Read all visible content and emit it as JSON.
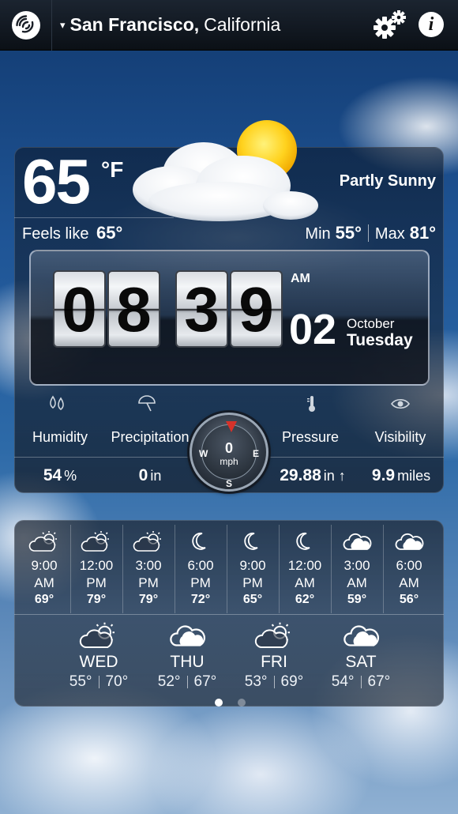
{
  "header": {
    "location_city": "San Francisco,",
    "location_state": "California",
    "location_caret": "▾"
  },
  "current": {
    "temperature": "65",
    "unit": "°F",
    "condition": "Partly Sunny",
    "feels_like_label": "Feels like",
    "feels_like_value": "65°",
    "min_label": "Min",
    "min_value": "55°",
    "max_label": "Max",
    "max_value": "81°"
  },
  "clock": {
    "h1": "0",
    "h2": "8",
    "m1": "3",
    "m2": "9",
    "ampm": "AM",
    "day": "02",
    "month": "October",
    "weekday": "Tuesday"
  },
  "stats": {
    "humidity": {
      "label": "Humidity",
      "value": "54",
      "unit": "%"
    },
    "precipitation": {
      "label": "Precipitation",
      "value": "0",
      "unit": "in"
    },
    "pressure": {
      "label": "Pressure",
      "value": "29.88",
      "unit": "in ↑"
    },
    "visibility": {
      "label": "Visibility",
      "value": "9.9",
      "unit": "miles"
    }
  },
  "wind": {
    "speed": "0",
    "unit": "mph",
    "n": "N",
    "e": "E",
    "s": "S",
    "w": "W"
  },
  "hourly": [
    {
      "time": "9:00",
      "period": "AM",
      "temp": "69°",
      "icon": "partly-sunny-icon"
    },
    {
      "time": "12:00",
      "period": "PM",
      "temp": "79°",
      "icon": "partly-sunny-icon"
    },
    {
      "time": "3:00",
      "period": "PM",
      "temp": "79°",
      "icon": "partly-sunny-icon"
    },
    {
      "time": "6:00",
      "period": "PM",
      "temp": "72°",
      "icon": "moon-icon"
    },
    {
      "time": "9:00",
      "period": "PM",
      "temp": "65°",
      "icon": "moon-icon"
    },
    {
      "time": "12:00",
      "period": "AM",
      "temp": "62°",
      "icon": "moon-icon"
    },
    {
      "time": "3:00",
      "period": "AM",
      "temp": "59°",
      "icon": "cloud-icon"
    },
    {
      "time": "6:00",
      "period": "AM",
      "temp": "56°",
      "icon": "cloud-icon"
    }
  ],
  "daily": [
    {
      "day": "WED",
      "min": "55°",
      "max": "70°",
      "icon": "partly-sunny-icon"
    },
    {
      "day": "THU",
      "min": "52°",
      "max": "67°",
      "icon": "cloud-icon"
    },
    {
      "day": "FRI",
      "min": "53°",
      "max": "69°",
      "icon": "partly-sunny-icon"
    },
    {
      "day": "SAT",
      "min": "54°",
      "max": "67°",
      "icon": "cloud-icon"
    }
  ],
  "pager": {
    "pages": 2,
    "active": 1
  },
  "colors": {
    "accent_red": "#d6322a",
    "topbar": "#0b1016"
  }
}
